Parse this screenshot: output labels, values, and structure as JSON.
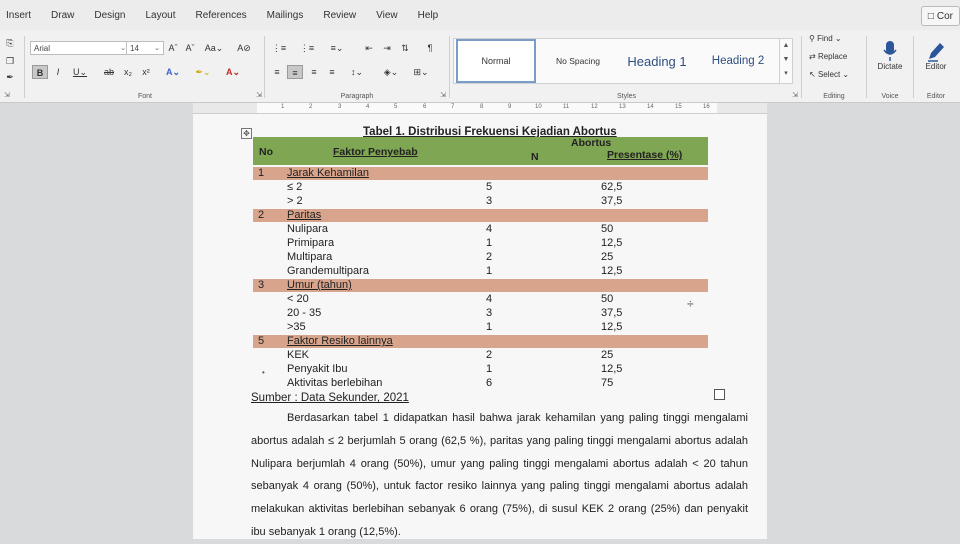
{
  "ribbon_tabs": [
    "Insert",
    "Draw",
    "Design",
    "Layout",
    "References",
    "Mailings",
    "Review",
    "View",
    "Help"
  ],
  "comments_label": "Cor",
  "font_group": {
    "font_name": "Arial",
    "font_size": "14",
    "label": "Font"
  },
  "paragraph_group": {
    "label": "Paragraph"
  },
  "styles_group": {
    "items": [
      "Normal",
      "No Spacing",
      "Heading 1",
      "Heading 2"
    ],
    "active": "Normal",
    "label": "Styles"
  },
  "editing_group": {
    "find": "Find",
    "replace": "Replace",
    "select": "Select",
    "label": "Editing"
  },
  "voice_group": {
    "dictate": "Dictate",
    "label": "Voice"
  },
  "editor_group": {
    "editor": "Editor",
    "label": "Editor"
  },
  "ruler_numbers": [
    "1",
    "2",
    "3",
    "4",
    "5",
    "6",
    "7",
    "8",
    "9",
    "10",
    "11",
    "12",
    "13",
    "14",
    "15",
    "16"
  ],
  "table": {
    "title": "Tabel 1. Distribusi Frekuensi Kejadian Abortus",
    "header": {
      "no": "No",
      "faktor": "Faktor Penyebab",
      "abortus": "Abortus",
      "n": "N",
      "presentase": "Presentase (%)"
    },
    "sections": [
      {
        "no": "1",
        "label": "Jarak Kehamilan",
        "rows": [
          {
            "label": "≤ 2",
            "n": "5",
            "p": "62,5"
          },
          {
            "label": "> 2",
            "n": "3",
            "p": "37,5"
          }
        ]
      },
      {
        "no": "2",
        "label": "Paritas",
        "rows": [
          {
            "label": "Nulipara",
            "n": "4",
            "p": "50"
          },
          {
            "label": "Primipara",
            "n": "1",
            "p": "12,5"
          },
          {
            "label": "Multipara",
            "n": "2",
            "p": "25"
          },
          {
            "label": "Grandemultipara",
            "n": "1",
            "p": "12,5"
          }
        ]
      },
      {
        "no": "3",
        "label": "Umur (tahun)",
        "rows": [
          {
            "label": "< 20",
            "n": "4",
            "p": "50"
          },
          {
            "label": "20 - 35",
            "n": "3",
            "p": "37,5"
          },
          {
            "label": ">35",
            "n": "1",
            "p": "12,5"
          }
        ]
      },
      {
        "no": "5",
        "label": "Faktor Resiko lainnya",
        "rows": [
          {
            "label": "KEK",
            "n": "2",
            "p": "25"
          },
          {
            "label": "Penyakit Ibu",
            "n": "1",
            "p": "12,5"
          },
          {
            "label": "Aktivitas berlebihan",
            "n": "6",
            "p": "75"
          }
        ]
      }
    ]
  },
  "source_line": "Sumber : Data Sekunder, 2021",
  "paragraph": "Berdasarkan tabel 1 didapatkan hasil  bahwa  jarak kehamilan yang paling tinggi mengalami abortus adalah ≤ 2 berjumlah 5 orang (62,5 %), paritas yang paling tinggi mengalami abortus adalah Nulipara berjumlah 4 orang (50%), umur yang paling tinggi mengalami abortus adalah < 20 tahun sebanyak 4 orang (50%), untuk factor resiko lainnya yang paling tinggi mengalami abortus adalah melakukan aktivitas berlebihan sebanyak 6 orang (75%), di susul KEK 2 orang (25%) dan penyakit ibu sebanyak 1 orang (12,5%)."
}
